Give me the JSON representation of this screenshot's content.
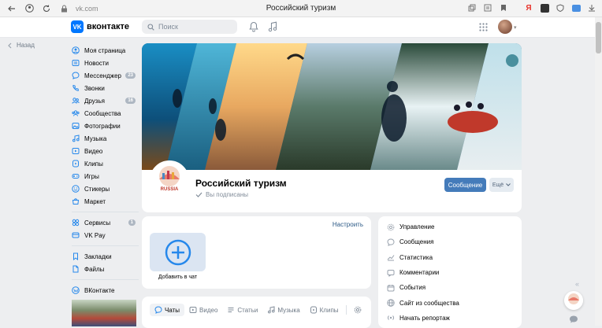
{
  "browser": {
    "url": "vk.com",
    "title": "Российский туризм"
  },
  "header": {
    "logo_text": "вконтакте",
    "logo_mark": "VK",
    "search_placeholder": "Поиск"
  },
  "nav": {
    "back_label": "Назад"
  },
  "sidebar": {
    "items": [
      {
        "label": "Моя страница",
        "icon": "user-icon"
      },
      {
        "label": "Новости",
        "icon": "news-icon"
      },
      {
        "label": "Мессенджер",
        "icon": "messenger-icon",
        "badge": "23"
      },
      {
        "label": "Звонки",
        "icon": "phone-icon"
      },
      {
        "label": "Друзья",
        "icon": "friends-icon",
        "badge": "16"
      },
      {
        "label": "Сообщества",
        "icon": "communities-icon"
      },
      {
        "label": "Фотографии",
        "icon": "photos-icon"
      },
      {
        "label": "Музыка",
        "icon": "music-icon"
      },
      {
        "label": "Видео",
        "icon": "video-icon"
      },
      {
        "label": "Клипы",
        "icon": "clips-icon"
      },
      {
        "label": "Игры",
        "icon": "games-icon"
      },
      {
        "label": "Стикеры",
        "icon": "stickers-icon"
      },
      {
        "label": "Маркет",
        "icon": "market-icon"
      }
    ],
    "services": [
      {
        "label": "Сервисы",
        "icon": "services-icon",
        "badge": "1"
      },
      {
        "label": "VK Pay",
        "icon": "vkpay-icon"
      }
    ],
    "extras": [
      {
        "label": "Закладки",
        "icon": "bookmark-icon"
      },
      {
        "label": "Файлы",
        "icon": "files-icon"
      }
    ],
    "footer": [
      {
        "label": "ВКонтакте",
        "icon": "vk-icon"
      }
    ]
  },
  "community": {
    "name": "Российский туризм",
    "subscription_status": "Вы подписаны",
    "message_button": "Сообщение",
    "more_button": "Ещё",
    "avatar_text": "RUSSIA"
  },
  "chats": {
    "setup_link": "Настроить",
    "add_chat_label": "Добавить в чат"
  },
  "content_tabs": [
    {
      "label": "Чаты",
      "icon": "chat-icon",
      "active": true
    },
    {
      "label": "Видео",
      "icon": "video-icon"
    },
    {
      "label": "Статьи",
      "icon": "articles-icon"
    },
    {
      "label": "Музыка",
      "icon": "music-icon"
    },
    {
      "label": "Клипы",
      "icon": "clips-icon"
    }
  ],
  "admin_menu": [
    {
      "label": "Управление",
      "icon": "gear-icon"
    },
    {
      "label": "Сообщения",
      "icon": "message-icon"
    },
    {
      "label": "Статистика",
      "icon": "stats-icon"
    },
    {
      "label": "Комментарии",
      "icon": "comments-icon"
    },
    {
      "label": "События",
      "icon": "events-icon"
    },
    {
      "label": "Сайт из сообщества",
      "icon": "globe-icon"
    },
    {
      "label": "Начать репортаж",
      "icon": "broadcast-icon"
    }
  ],
  "colors": {
    "accent": "#2688eb",
    "button": "#447bba",
    "background": "#edeef0"
  }
}
